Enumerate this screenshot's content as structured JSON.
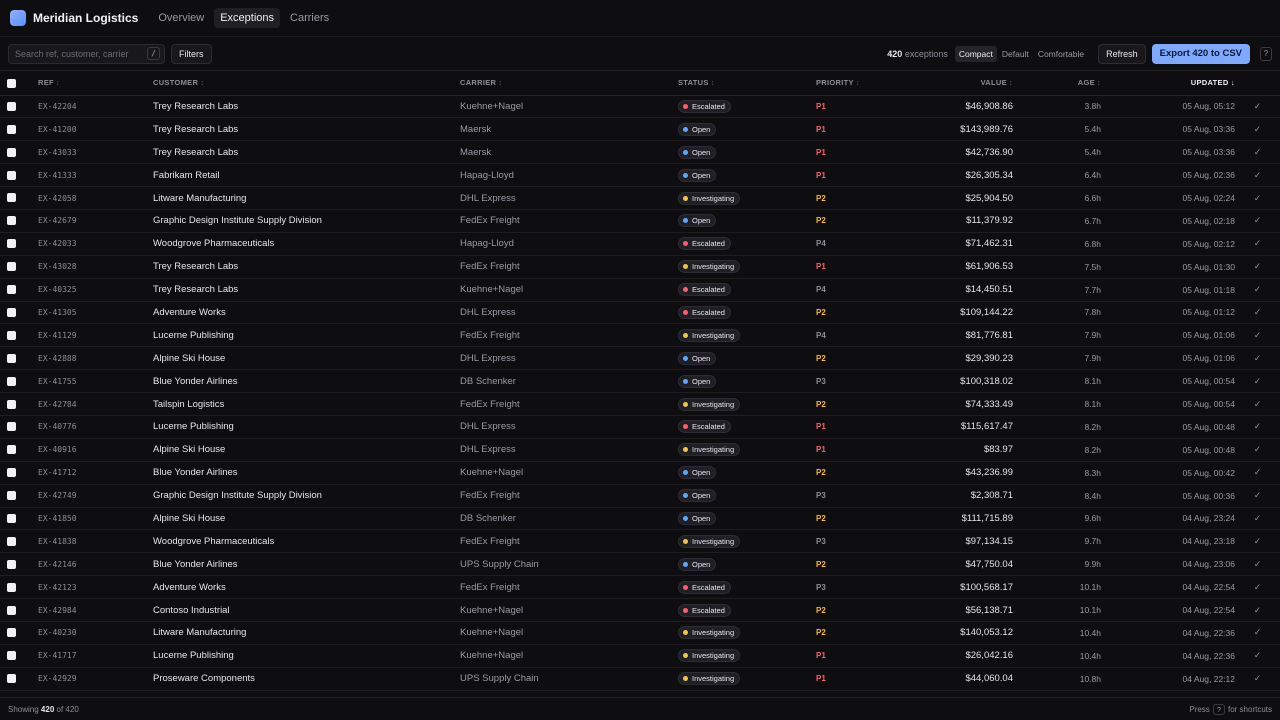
{
  "app": {
    "brand": "Meridian Logistics"
  },
  "nav": {
    "tabs": [
      {
        "label": "Overview",
        "active": false
      },
      {
        "label": "Exceptions",
        "active": true
      },
      {
        "label": "Carriers",
        "active": false
      }
    ]
  },
  "toolbar": {
    "search_placeholder": "Search ref, customer, carrier",
    "search_shortcut": "/",
    "filters_label": "Filters",
    "count_value": "420",
    "count_label": "exceptions",
    "density": [
      {
        "label": "Compact",
        "active": true
      },
      {
        "label": "Default",
        "active": false
      },
      {
        "label": "Comfortable",
        "active": false
      }
    ],
    "refresh_label": "Refresh",
    "export_label": "Export 420 to CSV",
    "help_label": "?"
  },
  "colors": {
    "Escalated": "#ff5c6c",
    "Open": "#5aa9ff",
    "Investigating": "#f5c542",
    "P1": "#ff5c6c",
    "P2": "#f5b83d",
    "P3": "#8d8d96",
    "P4": "#8d8d96"
  },
  "table": {
    "headers": {
      "ref": "REF",
      "customer": "CUSTOMER",
      "carrier": "CARRIER",
      "status": "STATUS",
      "priority": "PRIORITY",
      "value": "VALUE",
      "age": "AGE",
      "updated": "UPDATED"
    },
    "sorted_by": "updated",
    "sort_direction": "desc",
    "sorted_icon": "↓",
    "unsorted_icon": "↕",
    "done_icon": "✓",
    "rows": [
      {
        "ref": "EX-42204",
        "customer": "Trey Research Labs",
        "carrier": "Kuehne+Nagel",
        "status": "Escalated",
        "priority": "P1",
        "value": "$46,908.86",
        "age": "3.8h",
        "updated": "05 Aug, 05:12"
      },
      {
        "ref": "EX-41200",
        "customer": "Trey Research Labs",
        "carrier": "Maersk",
        "status": "Open",
        "priority": "P1",
        "value": "$143,989.76",
        "age": "5.4h",
        "updated": "05 Aug, 03:36"
      },
      {
        "ref": "EX-43033",
        "customer": "Trey Research Labs",
        "carrier": "Maersk",
        "status": "Open",
        "priority": "P1",
        "value": "$42,736.90",
        "age": "5.4h",
        "updated": "05 Aug, 03:36"
      },
      {
        "ref": "EX-41333",
        "customer": "Fabrikam Retail",
        "carrier": "Hapag-Lloyd",
        "status": "Open",
        "priority": "P1",
        "value": "$26,305.34",
        "age": "6.4h",
        "updated": "05 Aug, 02:36"
      },
      {
        "ref": "EX-42058",
        "customer": "Litware Manufacturing",
        "carrier": "DHL Express",
        "status": "Investigating",
        "priority": "P2",
        "value": "$25,904.50",
        "age": "6.6h",
        "updated": "05 Aug, 02:24"
      },
      {
        "ref": "EX-42679",
        "customer": "Graphic Design Institute Supply Division",
        "carrier": "FedEx Freight",
        "status": "Open",
        "priority": "P2",
        "value": "$11,379.92",
        "age": "6.7h",
        "updated": "05 Aug, 02:18"
      },
      {
        "ref": "EX-42033",
        "customer": "Woodgrove Pharmaceuticals",
        "carrier": "Hapag-Lloyd",
        "status": "Escalated",
        "priority": "P4",
        "value": "$71,462.31",
        "age": "6.8h",
        "updated": "05 Aug, 02:12"
      },
      {
        "ref": "EX-43028",
        "customer": "Trey Research Labs",
        "carrier": "FedEx Freight",
        "status": "Investigating",
        "priority": "P1",
        "value": "$61,906.53",
        "age": "7.5h",
        "updated": "05 Aug, 01:30"
      },
      {
        "ref": "EX-40325",
        "customer": "Trey Research Labs",
        "carrier": "Kuehne+Nagel",
        "status": "Escalated",
        "priority": "P4",
        "value": "$14,450.51",
        "age": "7.7h",
        "updated": "05 Aug, 01:18"
      },
      {
        "ref": "EX-41305",
        "customer": "Adventure Works",
        "carrier": "DHL Express",
        "status": "Escalated",
        "priority": "P2",
        "value": "$109,144.22",
        "age": "7.8h",
        "updated": "05 Aug, 01:12"
      },
      {
        "ref": "EX-41129",
        "customer": "Lucerne Publishing",
        "carrier": "FedEx Freight",
        "status": "Investigating",
        "priority": "P4",
        "value": "$81,776.81",
        "age": "7.9h",
        "updated": "05 Aug, 01:06"
      },
      {
        "ref": "EX-42888",
        "customer": "Alpine Ski House",
        "carrier": "DHL Express",
        "status": "Open",
        "priority": "P2",
        "value": "$29,390.23",
        "age": "7.9h",
        "updated": "05 Aug, 01:06"
      },
      {
        "ref": "EX-41755",
        "customer": "Blue Yonder Airlines",
        "carrier": "DB Schenker",
        "status": "Open",
        "priority": "P3",
        "value": "$100,318.02",
        "age": "8.1h",
        "updated": "05 Aug, 00:54"
      },
      {
        "ref": "EX-42784",
        "customer": "Tailspin Logistics",
        "carrier": "FedEx Freight",
        "status": "Investigating",
        "priority": "P2",
        "value": "$74,333.49",
        "age": "8.1h",
        "updated": "05 Aug, 00:54"
      },
      {
        "ref": "EX-40776",
        "customer": "Lucerne Publishing",
        "carrier": "DHL Express",
        "status": "Escalated",
        "priority": "P1",
        "value": "$115,617.47",
        "age": "8.2h",
        "updated": "05 Aug, 00:48"
      },
      {
        "ref": "EX-40916",
        "customer": "Alpine Ski House",
        "carrier": "DHL Express",
        "status": "Investigating",
        "priority": "P1",
        "value": "$83.97",
        "age": "8.2h",
        "updated": "05 Aug, 00:48"
      },
      {
        "ref": "EX-41712",
        "customer": "Blue Yonder Airlines",
        "carrier": "Kuehne+Nagel",
        "status": "Open",
        "priority": "P2",
        "value": "$43,236.99",
        "age": "8.3h",
        "updated": "05 Aug, 00:42"
      },
      {
        "ref": "EX-42749",
        "customer": "Graphic Design Institute Supply Division",
        "carrier": "FedEx Freight",
        "status": "Open",
        "priority": "P3",
        "value": "$2,308.71",
        "age": "8.4h",
        "updated": "05 Aug, 00:36"
      },
      {
        "ref": "EX-41850",
        "customer": "Alpine Ski House",
        "carrier": "DB Schenker",
        "status": "Open",
        "priority": "P2",
        "value": "$111,715.89",
        "age": "9.6h",
        "updated": "04 Aug, 23:24"
      },
      {
        "ref": "EX-41838",
        "customer": "Woodgrove Pharmaceuticals",
        "carrier": "FedEx Freight",
        "status": "Investigating",
        "priority": "P3",
        "value": "$97,134.15",
        "age": "9.7h",
        "updated": "04 Aug, 23:18"
      },
      {
        "ref": "EX-42146",
        "customer": "Blue Yonder Airlines",
        "carrier": "UPS Supply Chain",
        "status": "Open",
        "priority": "P2",
        "value": "$47,750.04",
        "age": "9.9h",
        "updated": "04 Aug, 23:06"
      },
      {
        "ref": "EX-42123",
        "customer": "Adventure Works",
        "carrier": "FedEx Freight",
        "status": "Escalated",
        "priority": "P3",
        "value": "$100,568.17",
        "age": "10.1h",
        "updated": "04 Aug, 22:54"
      },
      {
        "ref": "EX-42984",
        "customer": "Contoso Industrial",
        "carrier": "Kuehne+Nagel",
        "status": "Escalated",
        "priority": "P2",
        "value": "$56,138.71",
        "age": "10.1h",
        "updated": "04 Aug, 22:54"
      },
      {
        "ref": "EX-40230",
        "customer": "Litware Manufacturing",
        "carrier": "Kuehne+Nagel",
        "status": "Investigating",
        "priority": "P2",
        "value": "$140,053.12",
        "age": "10.4h",
        "updated": "04 Aug, 22:36"
      },
      {
        "ref": "EX-41717",
        "customer": "Lucerne Publishing",
        "carrier": "Kuehne+Nagel",
        "status": "Investigating",
        "priority": "P1",
        "value": "$26,042.16",
        "age": "10.4h",
        "updated": "04 Aug, 22:36"
      },
      {
        "ref": "EX-42929",
        "customer": "Proseware Components",
        "carrier": "UPS Supply Chain",
        "status": "Investigating",
        "priority": "P1",
        "value": "$44,060.04",
        "age": "10.8h",
        "updated": "04 Aug, 22:12"
      }
    ]
  },
  "footer": {
    "showing_prefix": "Showing",
    "showing_count": "420",
    "showing_of": "of",
    "showing_total": "420",
    "shortcut_prefix": "Press",
    "shortcut_key": "?",
    "shortcut_suffix": "for shortcuts"
  }
}
